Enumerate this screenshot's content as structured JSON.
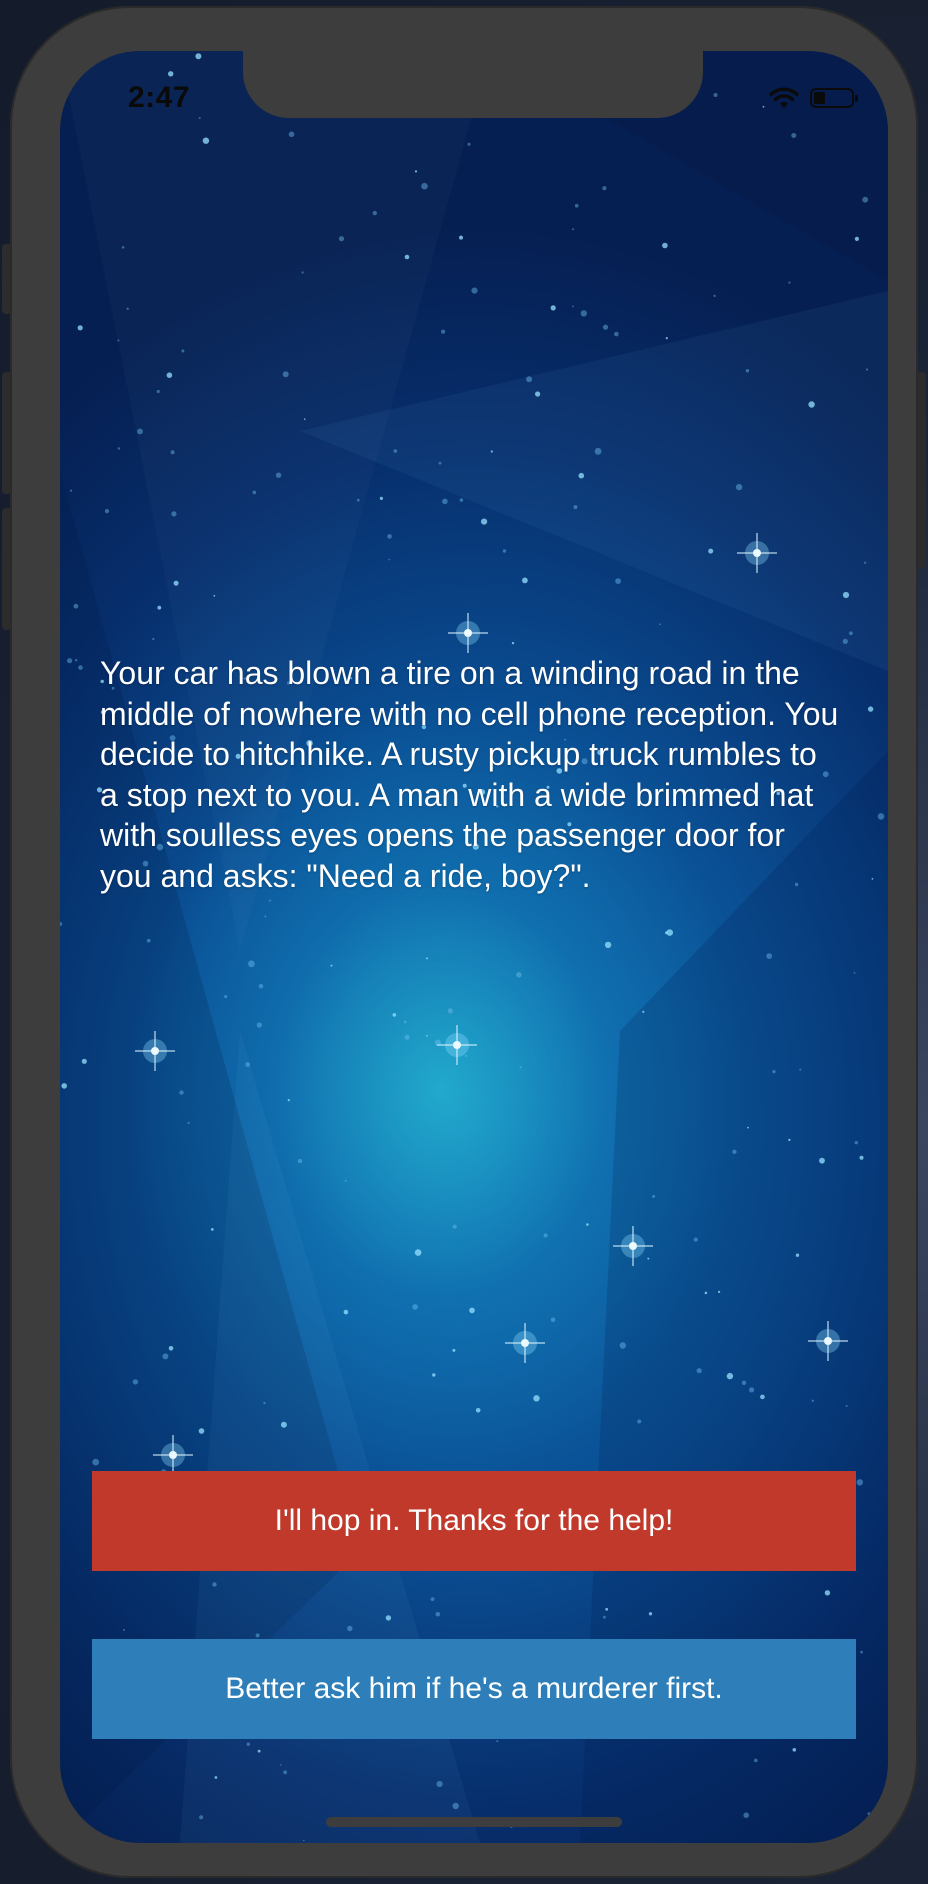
{
  "status_bar": {
    "time": "2:47",
    "battery_level": 0.3,
    "wifi_icon": "wifi-icon",
    "battery_icon": "battery-icon"
  },
  "story": {
    "text": "Your car has blown a tire on a winding road in the middle of nowhere with no cell phone reception. You decide to hitchhike. A rusty pickup truck rumbles to a stop next to you. A man with a wide brimmed hat with soulless eyes opens the passenger door for you and asks: \"Need a ride, boy?\"."
  },
  "choices": [
    {
      "label": "I'll hop in. Thanks for the help!",
      "color": "#c0392b"
    },
    {
      "label": "Better ask him if he's a murderer first.",
      "color": "#2e7fb9"
    }
  ],
  "colors": {
    "phone_frame": "#3d3d3d",
    "background_top": "#061f52",
    "background_glow": "#1ec0d8",
    "text": "#ffffff",
    "home_indicator": "#3d3d3d"
  }
}
